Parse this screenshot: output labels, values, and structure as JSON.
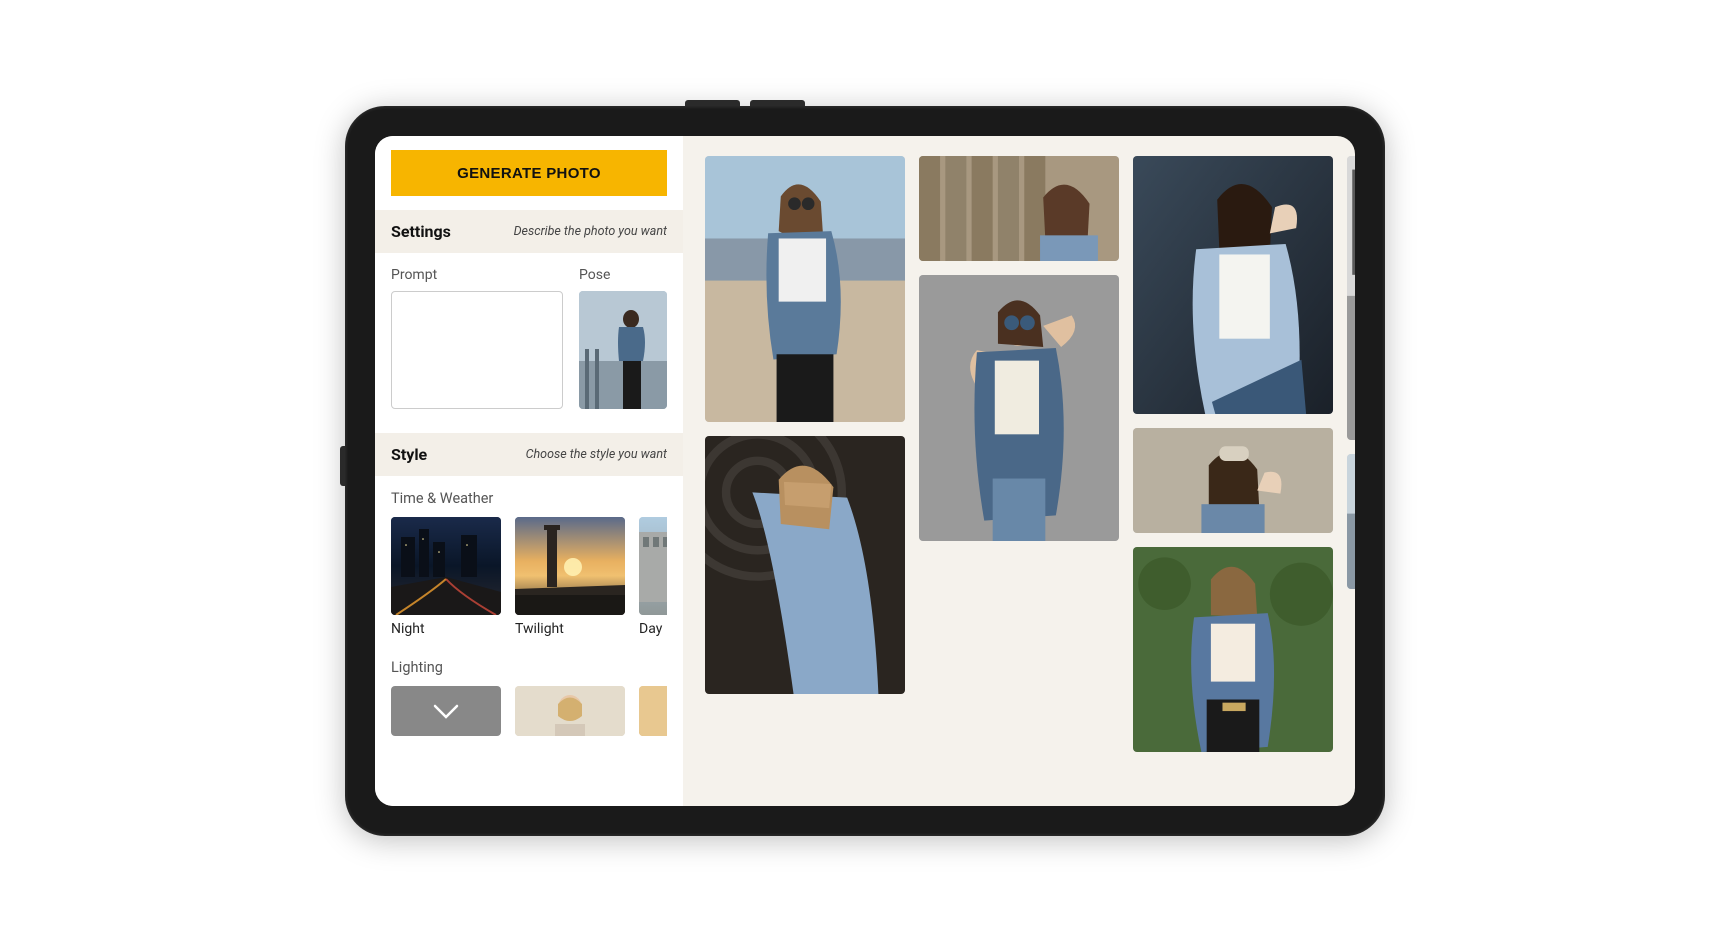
{
  "actions": {
    "generate_label": "GENERATE PHOTO"
  },
  "sections": {
    "settings": {
      "title": "Settings",
      "subtitle": "Describe the photo you want"
    },
    "style": {
      "title": "Style",
      "subtitle": "Choose the style you want"
    }
  },
  "prompt": {
    "label": "Prompt",
    "value": ""
  },
  "pose": {
    "label": "Pose"
  },
  "time_weather": {
    "label": "Time & Weather",
    "options": [
      {
        "label": "Night"
      },
      {
        "label": "Twilight"
      },
      {
        "label": "Day"
      }
    ]
  },
  "lighting": {
    "label": "Lighting"
  },
  "colors": {
    "accent": "#f7b500",
    "panel": "#f3efe8",
    "canvas": "#f5f2ec"
  }
}
